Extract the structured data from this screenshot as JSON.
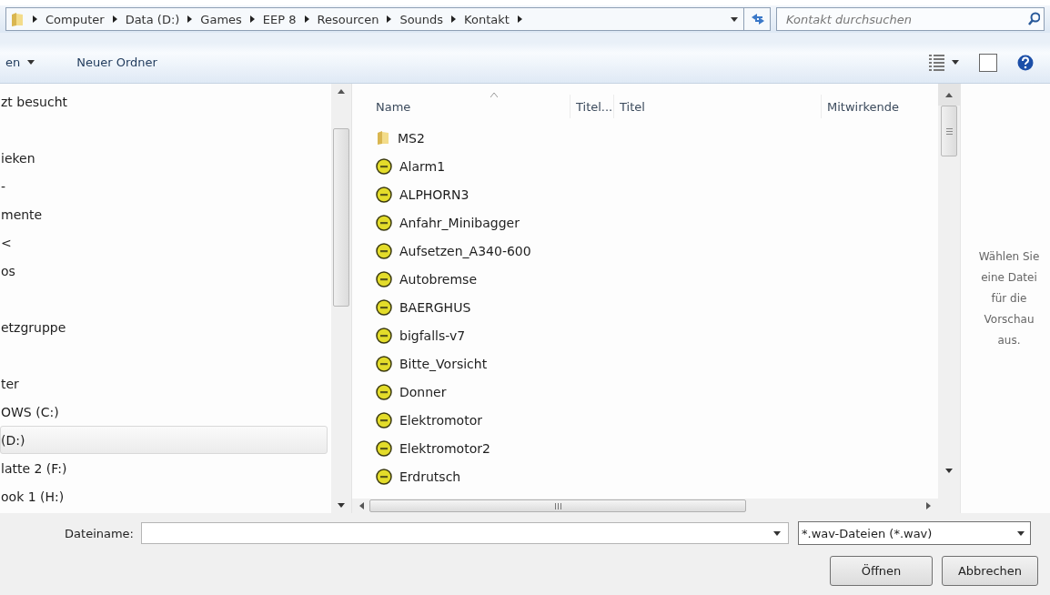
{
  "address_bar": {
    "crumbs": [
      "Computer",
      "Data (D:)",
      "Games",
      "EEP 8",
      "Resourcen",
      "Sounds",
      "Kontakt"
    ]
  },
  "search": {
    "placeholder": "Kontakt durchsuchen"
  },
  "toolbar": {
    "items": [
      "en",
      "Neuer Ordner"
    ]
  },
  "sidebar": {
    "items": [
      {
        "kind": "item",
        "label": "zt besucht",
        "selected": false
      },
      {
        "kind": "spacer"
      },
      {
        "kind": "item",
        "label": "ieken",
        "selected": false
      },
      {
        "kind": "item",
        "label": "-",
        "selected": false
      },
      {
        "kind": "item",
        "label": "mente",
        "selected": false
      },
      {
        "kind": "item",
        "label": "<",
        "selected": false
      },
      {
        "kind": "item",
        "label": "os",
        "selected": false
      },
      {
        "kind": "spacer"
      },
      {
        "kind": "item",
        "label": "etzgruppe",
        "selected": false
      },
      {
        "kind": "spacer"
      },
      {
        "kind": "item",
        "label": "ter",
        "selected": false
      },
      {
        "kind": "item",
        "label": "OWS (C:)",
        "selected": false
      },
      {
        "kind": "item",
        "label": "(D:)",
        "selected": true
      },
      {
        "kind": "item",
        "label": "latte 2 (F:)",
        "selected": false
      },
      {
        "kind": "item",
        "label": "ook 1 (H:)",
        "selected": false
      }
    ]
  },
  "file_list": {
    "columns": [
      "Name",
      "Titel...",
      "Titel",
      "Mitwirkende"
    ],
    "rows": [
      {
        "kind": "folder",
        "name": "MS2"
      },
      {
        "kind": "sound",
        "name": "Alarm1"
      },
      {
        "kind": "sound",
        "name": "ALPHORN3"
      },
      {
        "kind": "sound",
        "name": "Anfahr_Minibagger"
      },
      {
        "kind": "sound",
        "name": "Aufsetzen_A340-600"
      },
      {
        "kind": "sound",
        "name": "Autobremse"
      },
      {
        "kind": "sound",
        "name": "BAERGHUS"
      },
      {
        "kind": "sound",
        "name": "bigfalls-v7"
      },
      {
        "kind": "sound",
        "name": "Bitte_Vorsicht"
      },
      {
        "kind": "sound",
        "name": "Donner"
      },
      {
        "kind": "sound",
        "name": "Elektromotor"
      },
      {
        "kind": "sound",
        "name": "Elektromotor2"
      },
      {
        "kind": "sound",
        "name": "Erdrutsch"
      }
    ]
  },
  "preview": {
    "message": "Wählen Sie eine Datei für die Vorschau aus."
  },
  "footer": {
    "filename_label": "Dateiname:",
    "filter": "*.wav-Dateien (*.wav)",
    "buttons": [
      "Öffnen",
      "Abbrechen"
    ]
  }
}
